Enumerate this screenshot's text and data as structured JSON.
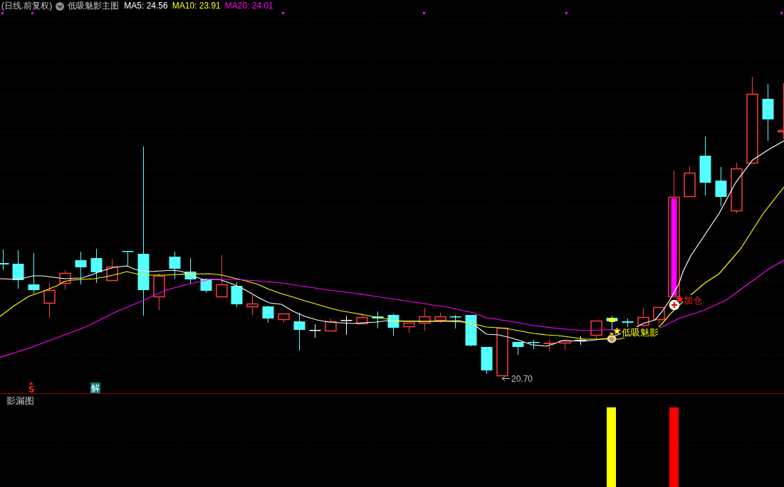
{
  "header": {
    "period": "(日线.前复权)",
    "indicator_name": "低吸魅影主图",
    "moving_averages": [
      {
        "label": "MA5: 24.56",
        "color": "#ffffff"
      },
      {
        "label": "MA10: 23.91",
        "color": "#ffff00"
      },
      {
        "label": "MA20: 24.01",
        "color": "#ff00ff"
      }
    ]
  },
  "main_chart": {
    "annotations": [
      {
        "kind": "low_price",
        "text": "20.70"
      },
      {
        "kind": "buy_signal",
        "text": "低吸魅影"
      },
      {
        "kind": "add_position",
        "text": "加仓"
      }
    ],
    "signals": [
      {
        "kind": "sell",
        "text": "S"
      },
      {
        "kind": "unlock",
        "text": "解"
      }
    ]
  },
  "sub_chart": {
    "title": "影漏图"
  }
}
